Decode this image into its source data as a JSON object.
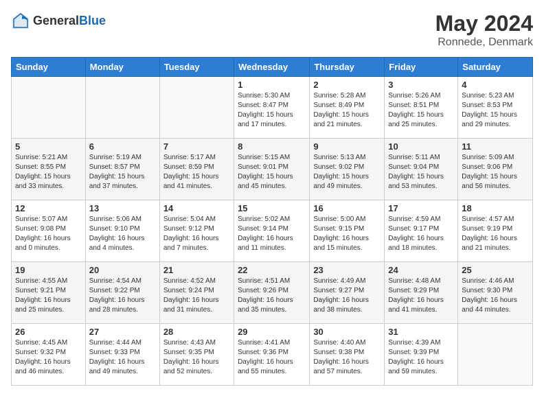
{
  "header": {
    "logo_general": "General",
    "logo_blue": "Blue",
    "month_year": "May 2024",
    "location": "Ronnede, Denmark"
  },
  "weekdays": [
    "Sunday",
    "Monday",
    "Tuesday",
    "Wednesday",
    "Thursday",
    "Friday",
    "Saturday"
  ],
  "weeks": [
    [
      {
        "day": "",
        "info": ""
      },
      {
        "day": "",
        "info": ""
      },
      {
        "day": "",
        "info": ""
      },
      {
        "day": "1",
        "info": "Sunrise: 5:30 AM\nSunset: 8:47 PM\nDaylight: 15 hours\nand 17 minutes."
      },
      {
        "day": "2",
        "info": "Sunrise: 5:28 AM\nSunset: 8:49 PM\nDaylight: 15 hours\nand 21 minutes."
      },
      {
        "day": "3",
        "info": "Sunrise: 5:26 AM\nSunset: 8:51 PM\nDaylight: 15 hours\nand 25 minutes."
      },
      {
        "day": "4",
        "info": "Sunrise: 5:23 AM\nSunset: 8:53 PM\nDaylight: 15 hours\nand 29 minutes."
      }
    ],
    [
      {
        "day": "5",
        "info": "Sunrise: 5:21 AM\nSunset: 8:55 PM\nDaylight: 15 hours\nand 33 minutes."
      },
      {
        "day": "6",
        "info": "Sunrise: 5:19 AM\nSunset: 8:57 PM\nDaylight: 15 hours\nand 37 minutes."
      },
      {
        "day": "7",
        "info": "Sunrise: 5:17 AM\nSunset: 8:59 PM\nDaylight: 15 hours\nand 41 minutes."
      },
      {
        "day": "8",
        "info": "Sunrise: 5:15 AM\nSunset: 9:01 PM\nDaylight: 15 hours\nand 45 minutes."
      },
      {
        "day": "9",
        "info": "Sunrise: 5:13 AM\nSunset: 9:02 PM\nDaylight: 15 hours\nand 49 minutes."
      },
      {
        "day": "10",
        "info": "Sunrise: 5:11 AM\nSunset: 9:04 PM\nDaylight: 15 hours\nand 53 minutes."
      },
      {
        "day": "11",
        "info": "Sunrise: 5:09 AM\nSunset: 9:06 PM\nDaylight: 15 hours\nand 56 minutes."
      }
    ],
    [
      {
        "day": "12",
        "info": "Sunrise: 5:07 AM\nSunset: 9:08 PM\nDaylight: 16 hours\nand 0 minutes."
      },
      {
        "day": "13",
        "info": "Sunrise: 5:06 AM\nSunset: 9:10 PM\nDaylight: 16 hours\nand 4 minutes."
      },
      {
        "day": "14",
        "info": "Sunrise: 5:04 AM\nSunset: 9:12 PM\nDaylight: 16 hours\nand 7 minutes."
      },
      {
        "day": "15",
        "info": "Sunrise: 5:02 AM\nSunset: 9:14 PM\nDaylight: 16 hours\nand 11 minutes."
      },
      {
        "day": "16",
        "info": "Sunrise: 5:00 AM\nSunset: 9:15 PM\nDaylight: 16 hours\nand 15 minutes."
      },
      {
        "day": "17",
        "info": "Sunrise: 4:59 AM\nSunset: 9:17 PM\nDaylight: 16 hours\nand 18 minutes."
      },
      {
        "day": "18",
        "info": "Sunrise: 4:57 AM\nSunset: 9:19 PM\nDaylight: 16 hours\nand 21 minutes."
      }
    ],
    [
      {
        "day": "19",
        "info": "Sunrise: 4:55 AM\nSunset: 9:21 PM\nDaylight: 16 hours\nand 25 minutes."
      },
      {
        "day": "20",
        "info": "Sunrise: 4:54 AM\nSunset: 9:22 PM\nDaylight: 16 hours\nand 28 minutes."
      },
      {
        "day": "21",
        "info": "Sunrise: 4:52 AM\nSunset: 9:24 PM\nDaylight: 16 hours\nand 31 minutes."
      },
      {
        "day": "22",
        "info": "Sunrise: 4:51 AM\nSunset: 9:26 PM\nDaylight: 16 hours\nand 35 minutes."
      },
      {
        "day": "23",
        "info": "Sunrise: 4:49 AM\nSunset: 9:27 PM\nDaylight: 16 hours\nand 38 minutes."
      },
      {
        "day": "24",
        "info": "Sunrise: 4:48 AM\nSunset: 9:29 PM\nDaylight: 16 hours\nand 41 minutes."
      },
      {
        "day": "25",
        "info": "Sunrise: 4:46 AM\nSunset: 9:30 PM\nDaylight: 16 hours\nand 44 minutes."
      }
    ],
    [
      {
        "day": "26",
        "info": "Sunrise: 4:45 AM\nSunset: 9:32 PM\nDaylight: 16 hours\nand 46 minutes."
      },
      {
        "day": "27",
        "info": "Sunrise: 4:44 AM\nSunset: 9:33 PM\nDaylight: 16 hours\nand 49 minutes."
      },
      {
        "day": "28",
        "info": "Sunrise: 4:43 AM\nSunset: 9:35 PM\nDaylight: 16 hours\nand 52 minutes."
      },
      {
        "day": "29",
        "info": "Sunrise: 4:41 AM\nSunset: 9:36 PM\nDaylight: 16 hours\nand 55 minutes."
      },
      {
        "day": "30",
        "info": "Sunrise: 4:40 AM\nSunset: 9:38 PM\nDaylight: 16 hours\nand 57 minutes."
      },
      {
        "day": "31",
        "info": "Sunrise: 4:39 AM\nSunset: 9:39 PM\nDaylight: 16 hours\nand 59 minutes."
      },
      {
        "day": "",
        "info": ""
      }
    ]
  ]
}
